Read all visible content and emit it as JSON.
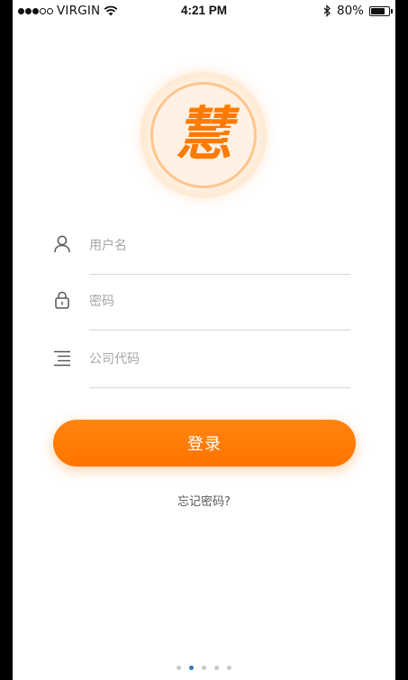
{
  "status_bar": {
    "carrier": "VIRGIN",
    "time": "4:21 PM",
    "battery": "80%",
    "battery_level": 0.8,
    "signal_strength": 3,
    "signal_max": 5
  },
  "logo": {
    "text": "慧",
    "color": "#ff7a00"
  },
  "form": {
    "username_placeholder": "用户名",
    "password_placeholder": "密码",
    "company_code_placeholder": "公司代码"
  },
  "login_button": {
    "label": "登录",
    "color": "#ff7a00"
  },
  "forgot_password": "忘记密码?",
  "pagination": {
    "count": 5,
    "active_index": 1
  },
  "icons": {
    "username": "user-icon",
    "password": "lock-icon",
    "company_code": "list-icon",
    "wifi": "wifi-icon",
    "bluetooth": "bluetooth-icon",
    "battery": "battery-icon"
  }
}
